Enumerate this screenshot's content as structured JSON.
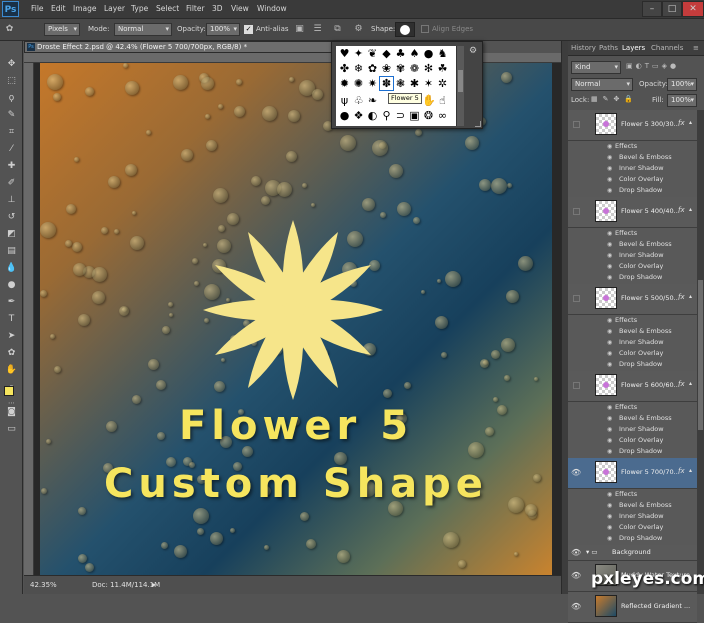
{
  "app": {
    "logo": "Ps"
  },
  "menu": [
    "File",
    "Edit",
    "Image",
    "Layer",
    "Type",
    "Select",
    "Filter",
    "3D",
    "View",
    "Window"
  ],
  "options": {
    "tool_mode": "Pixels",
    "mode_label": "Mode:",
    "mode_value": "Normal",
    "opacity_label": "Opacity:",
    "opacity_value": "100%",
    "antialias_label": "Anti-alias",
    "shape_label": "Shape:",
    "align_edges_label": "Align Edges"
  },
  "document": {
    "tab_title": "Droste Effect 2.psd @ 42.4% (Flower 5 700/700px, RGB/8) *",
    "zoom": "42.35%",
    "doc_size": "Doc: 11.4M/114.1M"
  },
  "shape_picker": {
    "tooltip": "Flower 5"
  },
  "canvas_text": {
    "line1": "Flower 5",
    "line2": "Custom Shape"
  },
  "panel": {
    "tabs": [
      "History",
      "Paths",
      "Layers",
      "Channels"
    ],
    "active_tab": "Layers",
    "kind_label": "Kind",
    "blend_mode": "Normal",
    "opacity_label": "Opacity:",
    "opacity_value": "100%",
    "lock_label": "Lock:",
    "fill_label": "Fill:",
    "fill_value": "100%"
  },
  "layers": [
    {
      "name": "Flower 5 300/30...",
      "fx": "fx",
      "selected": false,
      "visible": false
    },
    {
      "name": "Flower 5 400/40...",
      "fx": "fx",
      "selected": false,
      "visible": false
    },
    {
      "name": "Flower 5 500/50...",
      "fx": "fx",
      "selected": false,
      "visible": false
    },
    {
      "name": "Flower 5 600/60...",
      "fx": "fx",
      "selected": false,
      "visible": false
    },
    {
      "name": "Flower 5 700/70...",
      "fx": "fx",
      "selected": true,
      "visible": true
    }
  ],
  "effects_label": "Effects",
  "effects": [
    "Bevel & Emboss",
    "Inner Shadow",
    "Color Overlay",
    "Drop Shadow"
  ],
  "group": {
    "name": "Background"
  },
  "bottom_layers": [
    {
      "name": "Muddy Water Texture"
    },
    {
      "name": "Reflected Gradient ..."
    }
  ],
  "watermark": "pxleyes.com",
  "colors": {
    "accent_text": "#f6e55e",
    "flower": "#f6e58a",
    "selected_layer": "#4b6b8f"
  }
}
